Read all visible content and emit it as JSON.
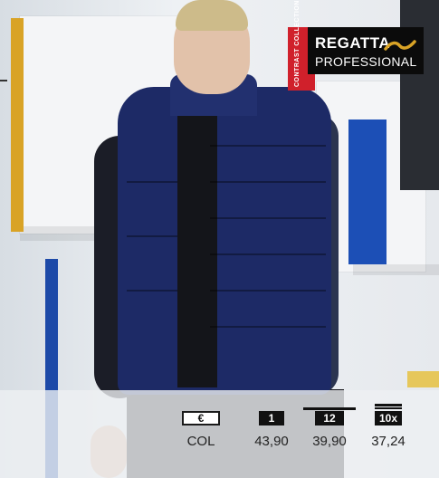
{
  "brand": {
    "tag": "CONTRAST COLLECTION",
    "name_line1": "REGATTA",
    "name_line2": "PROFESSIONAL",
    "mark_icon": "regatta-wave-icon",
    "colors": {
      "red": "#d0202b",
      "black": "#0b0b0b"
    }
  },
  "price_table": {
    "currency": "€",
    "columns": [
      {
        "head": "€",
        "value": "COL"
      },
      {
        "head": "1",
        "value": "43,90"
      },
      {
        "head": "12",
        "value": "39,90"
      },
      {
        "head": "10x",
        "value": "37,24"
      }
    ]
  }
}
